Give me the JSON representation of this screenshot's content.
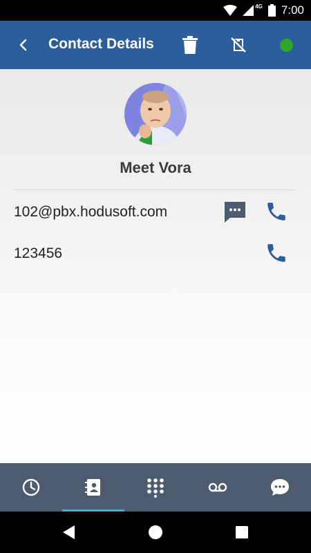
{
  "status_bar": {
    "time": "7:00",
    "network": "4G",
    "icons": [
      "wifi-icon",
      "signal-icon",
      "battery-icon"
    ]
  },
  "app_bar": {
    "title": "Contact Details",
    "background": "#2c5e9b",
    "presence_color": "#2fa82a",
    "icons": [
      "back-icon",
      "trash-icon",
      "phone-disabled-icon",
      "presence-dot"
    ]
  },
  "contact": {
    "name": "Meet Vora",
    "entries": [
      {
        "value": "102@pbx.hodusoft.com",
        "actions": [
          "chat-icon",
          "phone-icon"
        ]
      },
      {
        "value": "123456",
        "actions": [
          "phone-icon"
        ]
      }
    ]
  },
  "bottom_nav": {
    "background": "#4c5c6e",
    "active_index": 1,
    "active_underline": "#3bb4c8",
    "items": [
      "history-clock-icon",
      "contacts-book-icon",
      "dialpad-icon",
      "voicemail-icon",
      "messages-chat-icon"
    ]
  },
  "system_nav": [
    "back-triangle-icon",
    "home-circle-icon",
    "recents-square-icon"
  ]
}
